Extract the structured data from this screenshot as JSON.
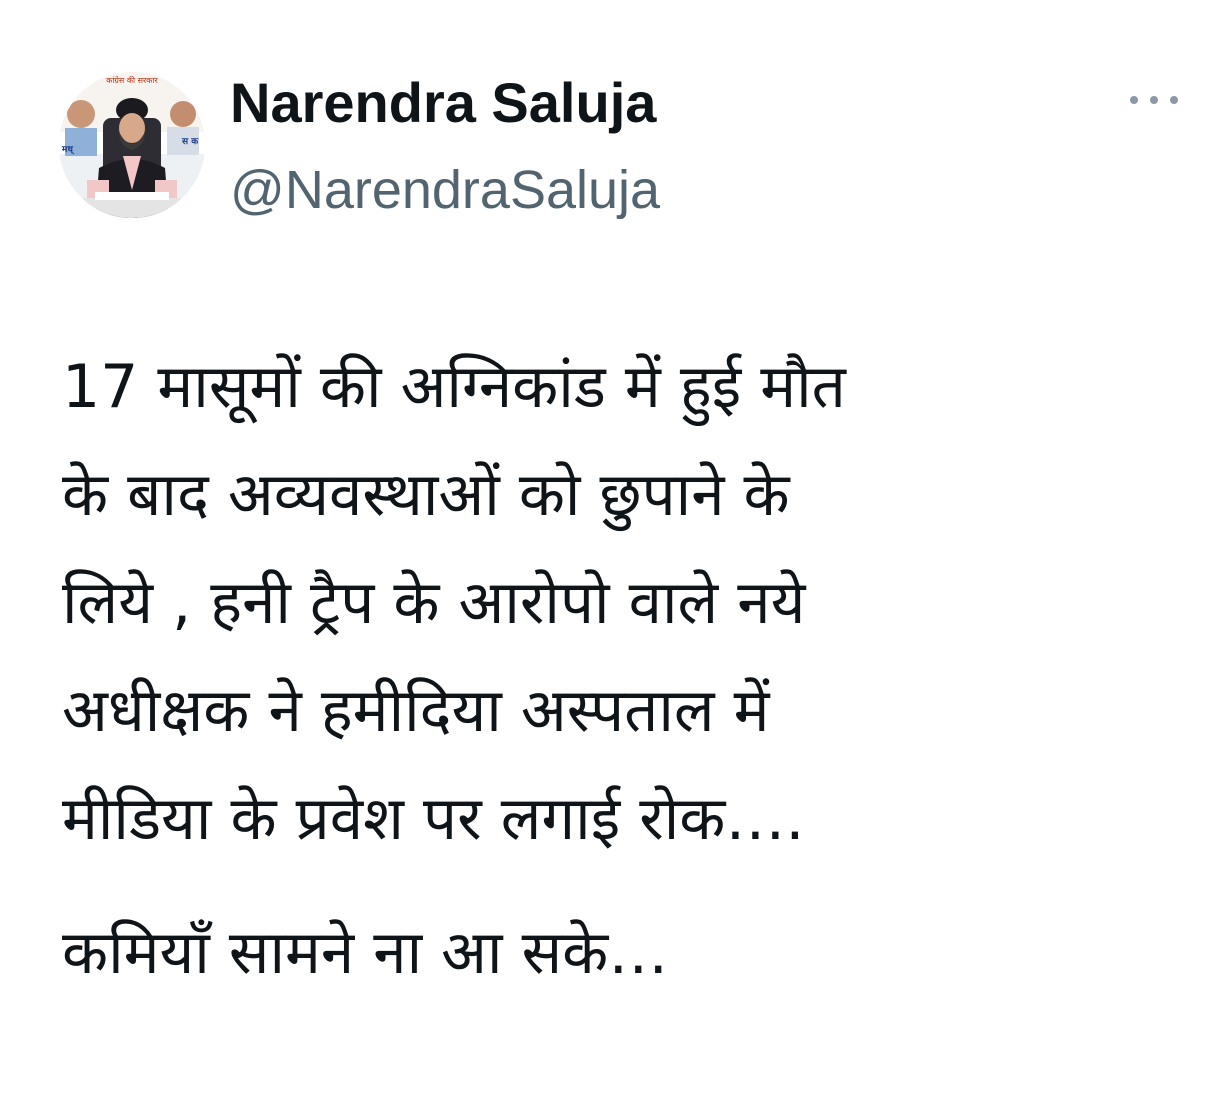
{
  "author": {
    "name": "Narendra Saluja",
    "handle": "@NarendraSaluja"
  },
  "avatar": {
    "banner_top": "कांग्रेस की सरकार",
    "banner_left": "मध्",
    "banner_right": "स क"
  },
  "menu": {
    "icon": "more-horizontal-icon"
  },
  "tweet": {
    "lines": [
      "17 मासूमों की अग्निकांड में हुई मौत",
      "के बाद अव्यवस्थाओं को छुपाने के",
      "लिये , हनी ट्रैप के आरोपो वाले नये",
      "अधीक्षक ने हमीदिया अस्पताल में",
      "मीडिया के प्रवेश पर लगाई रोक…."
    ],
    "second_paragraph": "कमियाँ सामने ना आ सके…"
  },
  "colors": {
    "text": "#0f1419",
    "secondary": "#536471",
    "background": "#ffffff"
  }
}
